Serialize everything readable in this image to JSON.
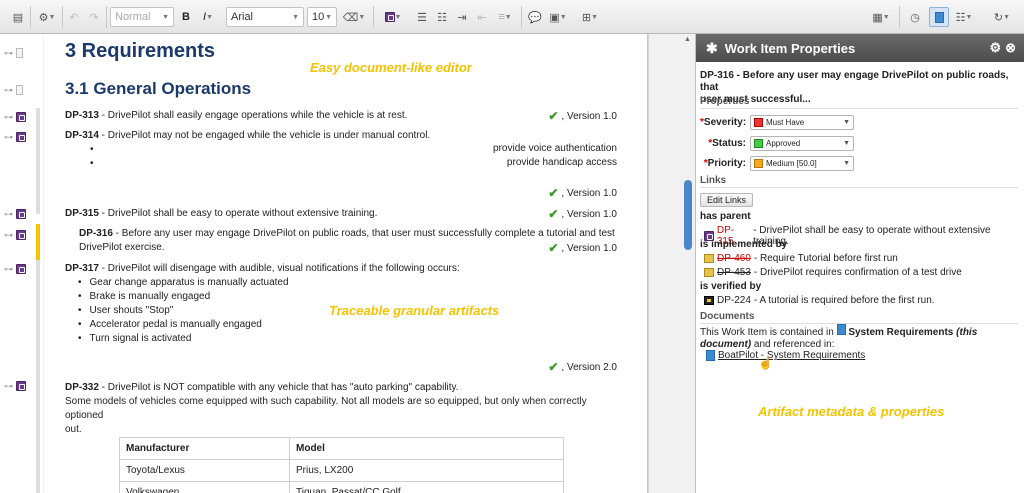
{
  "toolbar": {
    "style_select": "Normal",
    "font_select": "Arial",
    "size_select": "10",
    "bold": "B",
    "italic": "I"
  },
  "document": {
    "h1": "3 Requirements",
    "h2": "3.1 General Operations",
    "annotations": {
      "editor": "Easy document-like editor",
      "artifacts": "Traceable granular artifacts",
      "metadata": "Artifact metadata & properties"
    },
    "items": [
      {
        "id": "DP-313",
        "text": " - DrivePilot shall easily engage operations while the vehicle is at rest.",
        "version": ", Version 1.0"
      },
      {
        "id": "DP-314",
        "text": " - DrivePilot may not be engaged while the vehicle is under manual control.",
        "bullets": [
          "provide voice authentication",
          "provide handicap access"
        ],
        "version": ", Version 1.0"
      },
      {
        "id": "DP-315",
        "text": " - DrivePilot shall be easy to operate without extensive training.",
        "version": ", Version 1.0"
      },
      {
        "id": "DP-316",
        "text": " - Before any user may engage DrivePilot on public roads, that user must successfully complete a tutorial and test",
        "text2": "DrivePilot exercise.",
        "version": ", Version 1.0"
      },
      {
        "id": "DP-317",
        "text": " - DrivePilot will disengage with audible, visual notifications if the following occurs:",
        "bullets": [
          "Gear change apparatus is manually actuated",
          "Brake is manually engaged",
          "User shouts \"Stop\"",
          "Accelerator pedal is manually engaged",
          "Turn signal is activated"
        ],
        "version": ", Version 2.0"
      },
      {
        "id": "DP-332",
        "text": " - DrivePilot is NOT compatible with any vehicle that has \"auto parking\" capability.",
        "text2": "Some models of vehicles come equipped with such capability.  Not all models are so equipped, but only when correctly optioned",
        "text3": "out."
      }
    ],
    "table": {
      "headers": [
        "Manufacturer",
        "Model"
      ],
      "rows": [
        [
          "Toyota/Lexus",
          "Prius, LX200"
        ],
        [
          "Volkswagen",
          "Tiguan, Passat/CC Golf"
        ]
      ]
    }
  },
  "panel": {
    "title": "Work Item Properties",
    "item_id": "DP-316",
    "item_title_1": " - Before any user may engage DrivePilot on public roads, that",
    "item_title_2": "user must successful...",
    "properties_label": "Properties",
    "fields": {
      "severity_label": "Severity:",
      "severity_value": "Must Have",
      "status_label": "Status:",
      "status_value": "Approved",
      "priority_label": "Priority:",
      "priority_value": "Medium [50.0]"
    },
    "links_label": "Links",
    "edit_links": "Edit Links",
    "has_parent_label": "has parent",
    "parent": {
      "id": "DP-315",
      "text": " - DrivePilot shall be easy to operate without extensive training."
    },
    "implemented_label": "is implemented by",
    "implemented": [
      {
        "id": "DP-460",
        "text": " - Require Tutorial before first run"
      },
      {
        "id": "DP-453",
        "text": " - DrivePilot requires confirmation of a test drive"
      }
    ],
    "verified_label": "is verified by",
    "verified": {
      "id": "DP-224",
      "text": " - A tutorial  is required before the first run."
    },
    "documents_label": "Documents",
    "doc_text_1": "This Work Item is contained in ",
    "doc_name": "System Requirements",
    "doc_this": " (this",
    "doc_text_2_italic": "document)",
    "doc_text_2": " and referenced in:",
    "ref_doc": "BoatPilot - System Requirements"
  }
}
